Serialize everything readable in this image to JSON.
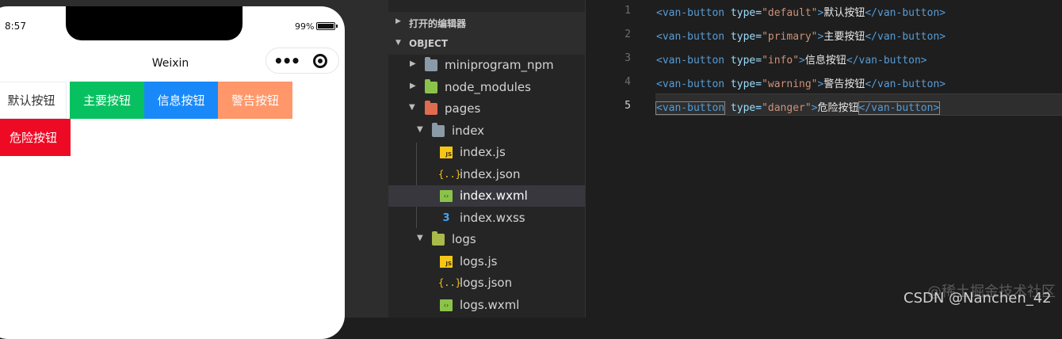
{
  "simulator": {
    "status_time": "8:57",
    "battery": "99%",
    "nav_title": "Weixin",
    "buttons": [
      {
        "type": "default",
        "label": "默认按钮",
        "color": "#ffffff"
      },
      {
        "type": "primary",
        "label": "主要按钮",
        "color": "#07c160"
      },
      {
        "type": "info",
        "label": "信息按钮",
        "color": "#1989fa"
      },
      {
        "type": "warning",
        "label": "警告按钮",
        "color": "#ff976a"
      },
      {
        "type": "danger",
        "label": "危险按钮",
        "color": "#ee0a24"
      }
    ]
  },
  "explorer": {
    "open_editors": "打开的编辑器",
    "project": "OBJECT",
    "tree": [
      {
        "label": "miniprogram_npm",
        "icon": "folder-icon"
      },
      {
        "label": "node_modules",
        "icon": "node-folder-icon"
      },
      {
        "label": "pages",
        "icon": "pages-folder-icon"
      },
      {
        "label": "index",
        "icon": "folder-open-icon"
      },
      {
        "label": "index.js",
        "icon": "js-file-icon"
      },
      {
        "label": "index.json",
        "icon": "json-file-icon"
      },
      {
        "label": "index.wxml",
        "icon": "wxml-file-icon",
        "selected": true
      },
      {
        "label": "index.wxss",
        "icon": "css-file-icon"
      },
      {
        "label": "logs",
        "icon": "folder-open-icon"
      },
      {
        "label": "logs.js",
        "icon": "js-file-icon"
      },
      {
        "label": "logs.json",
        "icon": "json-file-icon"
      },
      {
        "label": "logs.wxml",
        "icon": "wxml-file-icon"
      }
    ]
  },
  "editor": {
    "lines": [
      {
        "num": "1",
        "open": "<van-button",
        "attr": "type=",
        "value": "\"default\"",
        "close_open": ">",
        "text": "默认按钮",
        "end": "</van-button>"
      },
      {
        "num": "2",
        "open": "<van-button",
        "attr": "type=",
        "value": "\"primary\"",
        "close_open": ">",
        "text": "主要按钮",
        "end": "</van-button>"
      },
      {
        "num": "3",
        "open": "<van-button",
        "attr": "type=",
        "value": "\"info\"",
        "close_open": ">",
        "text": "信息按钮",
        "end": "</van-button>"
      },
      {
        "num": "4",
        "open": "<van-button",
        "attr": "type=",
        "value": "\"warning\"",
        "close_open": ">",
        "text": "警告按钮",
        "end": "</van-button>"
      },
      {
        "num": "5",
        "open": "<van-button",
        "attr": "type=",
        "value": "\"danger\"",
        "close_open": ">",
        "text": "危险按钮",
        "end": "</van-button>"
      }
    ]
  },
  "watermark": "CSDN @Nanchen_42",
  "watermark_faint": "@稀土掘金技术社区"
}
